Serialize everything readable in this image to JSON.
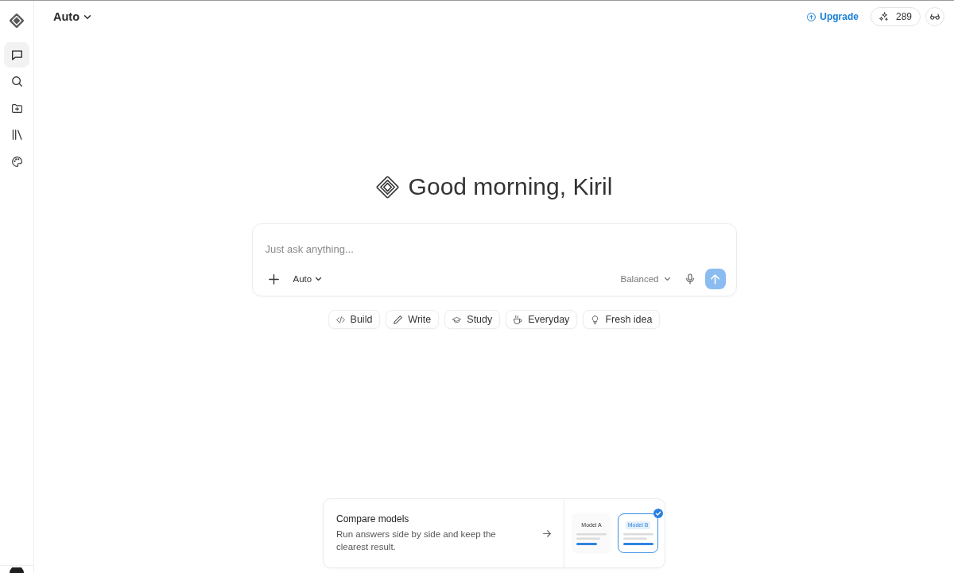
{
  "sidebar": {
    "items": [
      {
        "selected": true
      },
      {
        "selected": false
      },
      {
        "selected": false
      },
      {
        "selected": false
      },
      {
        "selected": false
      }
    ]
  },
  "top_bar": {
    "model_menu": "Auto",
    "upgrade": "Upgrade",
    "credits": "289"
  },
  "greeting": "Good morning, Kiril",
  "composer": {
    "placeholder": "Just ask anything...",
    "model": "Auto",
    "mode": "Balanced",
    "send": {
      "disabled": true
    }
  },
  "suggestions": [
    "Build",
    "Write",
    "Study",
    "Everyday",
    "Fresh idea"
  ],
  "promo": {
    "title": "Compare models",
    "description": "Run answers side by side and keep the clearest result.",
    "options": [
      {
        "label": "Model A",
        "selected": false
      },
      {
        "label": "Model B",
        "selected": true
      }
    ]
  }
}
